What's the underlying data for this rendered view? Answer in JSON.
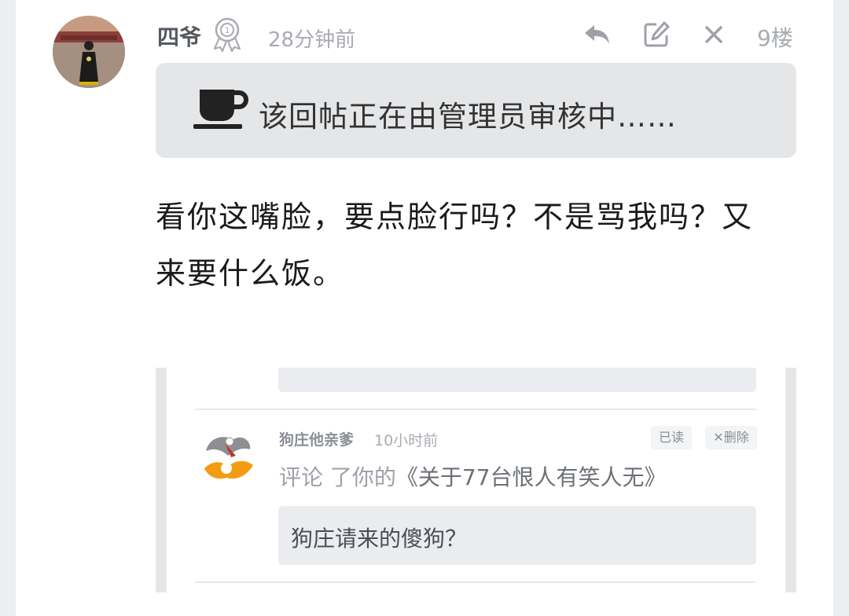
{
  "post": {
    "author": "四爷",
    "time": "28分钟前",
    "floor": "9楼",
    "pending_notice": "该回帖正在由管理员审核中……",
    "body_line1": "看你这嘴脸，要点脸行吗？不是骂我吗？又",
    "body_line2": "来要什么饭。"
  },
  "actions": {
    "reply": "reply-icon",
    "edit": "edit-icon",
    "close": "close-icon"
  },
  "embedded": {
    "top_dots": "···",
    "name": "狗庄他亲爹",
    "time": "10小时前",
    "read_label": "已读",
    "delete_label": "✕删除",
    "action_prefix": "评论 了你的",
    "post_title": "《关于77台恨人有笑人无》",
    "quote": "狗庄请来的傻狗？"
  },
  "colors": {
    "background": "#eceef1",
    "card": "#ffffff",
    "pending_box": "#e5e6e8",
    "muted_text": "#a8abb0"
  }
}
